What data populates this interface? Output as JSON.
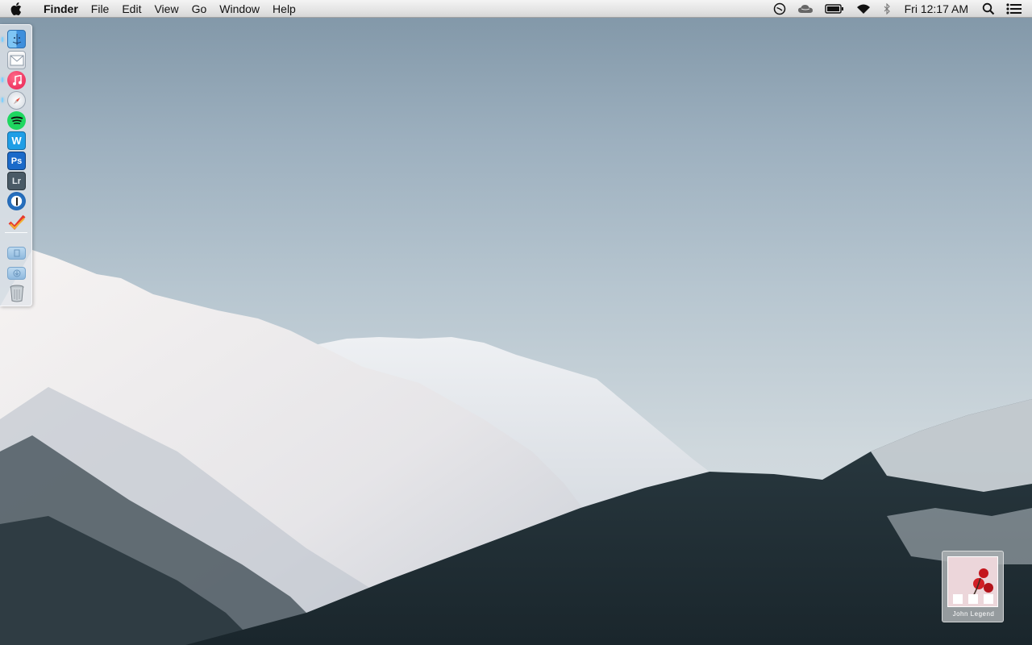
{
  "menubar": {
    "apple_icon": "apple-icon",
    "app_name": "Finder",
    "menus": [
      "File",
      "Edit",
      "View",
      "Go",
      "Window",
      "Help"
    ],
    "status_icons": [
      "time-machine-icon",
      "cloud-icon",
      "battery-icon",
      "wifi-icon",
      "bluetooth-icon"
    ],
    "clock": "Fri 12:17 AM",
    "right_icons": [
      "spotlight-search-icon",
      "notification-center-icon"
    ]
  },
  "dock": {
    "items": [
      {
        "name": "finder",
        "icon": "finder-icon",
        "running": true
      },
      {
        "name": "mail",
        "icon": "mail-icon",
        "running": false
      },
      {
        "name": "itunes",
        "icon": "itunes-icon",
        "running": true
      },
      {
        "name": "safari",
        "icon": "safari-icon",
        "running": true
      },
      {
        "name": "spotify",
        "icon": "spotify-icon",
        "running": false
      },
      {
        "name": "word",
        "icon": "word-icon",
        "running": false,
        "glyph": "W"
      },
      {
        "name": "photoshop",
        "icon": "photoshop-icon",
        "running": false,
        "glyph": "Ps"
      },
      {
        "name": "lightroom",
        "icon": "lightroom-icon",
        "running": false,
        "glyph": "Lr"
      },
      {
        "name": "1password",
        "icon": "1password-icon",
        "running": false
      },
      {
        "name": "wunderlist",
        "icon": "checkmark-icon",
        "running": false
      },
      {
        "name": "documents-folder",
        "icon": "folder-icon",
        "running": false
      },
      {
        "name": "downloads-folder",
        "icon": "downloads-folder-icon",
        "running": false
      },
      {
        "name": "trash",
        "icon": "trash-icon",
        "running": false
      }
    ]
  },
  "album_widget": {
    "artist": "John Legend",
    "art_icon": "album-art-roses-icon"
  },
  "colors": {
    "spotify": "#1ed760",
    "itunes": "#f4305a",
    "word": "#1f9ee6",
    "photoshop": "#1b6ac9",
    "lightroom": "#4a5a66",
    "sky_top": "#7f95a6",
    "sky_bottom": "#d9e0e3"
  }
}
